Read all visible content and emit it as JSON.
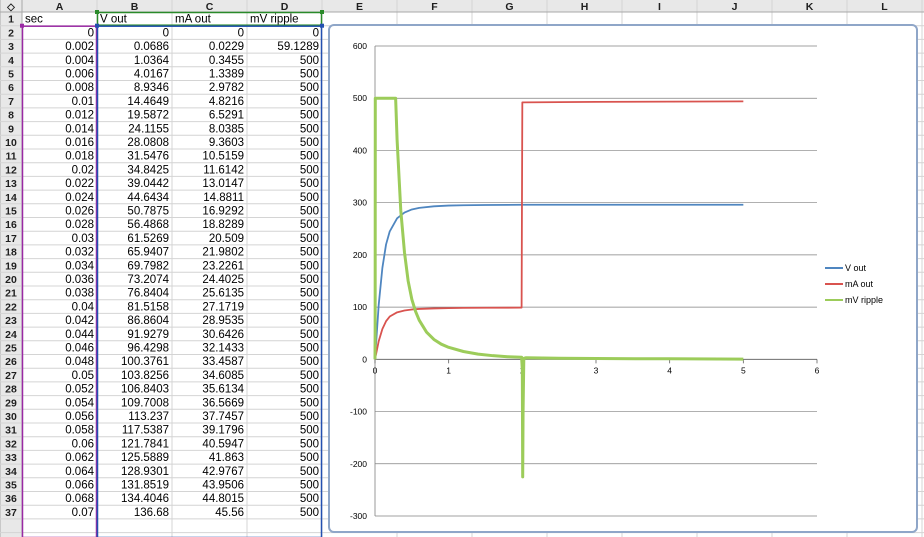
{
  "sheet": {
    "corner_label": "◇",
    "column_headers": [
      "A",
      "B",
      "C",
      "D",
      "E",
      "F",
      "G",
      "H",
      "I",
      "J",
      "K",
      "L"
    ],
    "row_headers": [
      "1",
      "2",
      "3",
      "4",
      "5",
      "6",
      "7",
      "8",
      "9",
      "10",
      "11",
      "12",
      "13",
      "14",
      "15",
      "16",
      "17",
      "18",
      "19",
      "20",
      "21",
      "22",
      "23",
      "24",
      "25",
      "26",
      "27",
      "28",
      "29",
      "30",
      "31",
      "32",
      "33",
      "34",
      "35",
      "36",
      "37"
    ],
    "header_cells": [
      "sec",
      "V out",
      "mA out",
      "mV ripple"
    ],
    "rows": [
      [
        "0",
        "0",
        "0",
        "0"
      ],
      [
        "0.002",
        "0.0686",
        "0.0229",
        "59.1289"
      ],
      [
        "0.004",
        "1.0364",
        "0.3455",
        "500"
      ],
      [
        "0.006",
        "4.0167",
        "1.3389",
        "500"
      ],
      [
        "0.008",
        "8.9346",
        "2.9782",
        "500"
      ],
      [
        "0.01",
        "14.4649",
        "4.8216",
        "500"
      ],
      [
        "0.012",
        "19.5872",
        "6.5291",
        "500"
      ],
      [
        "0.014",
        "24.1155",
        "8.0385",
        "500"
      ],
      [
        "0.016",
        "28.0808",
        "9.3603",
        "500"
      ],
      [
        "0.018",
        "31.5476",
        "10.5159",
        "500"
      ],
      [
        "0.02",
        "34.8425",
        "11.6142",
        "500"
      ],
      [
        "0.022",
        "39.0442",
        "13.0147",
        "500"
      ],
      [
        "0.024",
        "44.6434",
        "14.8811",
        "500"
      ],
      [
        "0.026",
        "50.7875",
        "16.9292",
        "500"
      ],
      [
        "0.028",
        "56.4868",
        "18.8289",
        "500"
      ],
      [
        "0.03",
        "61.5269",
        "20.509",
        "500"
      ],
      [
        "0.032",
        "65.9407",
        "21.9802",
        "500"
      ],
      [
        "0.034",
        "69.7982",
        "23.2261",
        "500"
      ],
      [
        "0.036",
        "73.2074",
        "24.4025",
        "500"
      ],
      [
        "0.038",
        "76.8404",
        "25.6135",
        "500"
      ],
      [
        "0.04",
        "81.5158",
        "27.1719",
        "500"
      ],
      [
        "0.042",
        "86.8604",
        "28.9535",
        "500"
      ],
      [
        "0.044",
        "91.9279",
        "30.6426",
        "500"
      ],
      [
        "0.046",
        "96.4298",
        "32.1433",
        "500"
      ],
      [
        "0.048",
        "100.3761",
        "33.4587",
        "500"
      ],
      [
        "0.05",
        "103.8256",
        "34.6085",
        "500"
      ],
      [
        "0.052",
        "106.8403",
        "35.6134",
        "500"
      ],
      [
        "0.054",
        "109.7008",
        "36.5669",
        "500"
      ],
      [
        "0.056",
        "113.237",
        "37.7457",
        "500"
      ],
      [
        "0.058",
        "117.5387",
        "39.1796",
        "500"
      ],
      [
        "0.06",
        "121.7841",
        "40.5947",
        "500"
      ],
      [
        "0.062",
        "125.5889",
        "41.863",
        "500"
      ],
      [
        "0.064",
        "128.9301",
        "42.9767",
        "500"
      ],
      [
        "0.066",
        "131.8519",
        "43.9506",
        "500"
      ],
      [
        "0.068",
        "134.4046",
        "44.8015",
        "500"
      ],
      [
        "0.07",
        "136.68",
        "45.56",
        "500"
      ]
    ],
    "colors": {
      "grid_line": "#d4d4d4",
      "header_fill": "#e8e8e8",
      "header_border": "#a8a8a8",
      "selection_purple": "#9a2aa4",
      "selection_green": "#2a8a2a",
      "selection_blue": "#2450b0"
    }
  },
  "chart_data": {
    "type": "line",
    "xlim": [
      0,
      6
    ],
    "ylim": [
      -300,
      600
    ],
    "x_ticks": [
      "0",
      "1",
      "2",
      "3",
      "4",
      "5",
      "6"
    ],
    "y_ticks": [
      "600",
      "500",
      "400",
      "300",
      "200",
      "100",
      "0",
      "-100",
      "-200",
      "-300"
    ],
    "grid": true,
    "legend_position": "right",
    "series": [
      {
        "name": "V out",
        "color": "#4f86c0",
        "x": [
          0,
          0.05,
          0.1,
          0.15,
          0.2,
          0.3,
          0.4,
          0.5,
          0.6,
          0.8,
          1,
          1.2,
          1.5,
          2,
          2.02,
          2.5,
          3,
          4,
          5
        ],
        "y": [
          0,
          103.8,
          175,
          220,
          245,
          270,
          281,
          287,
          290,
          293,
          294.5,
          295,
          295.5,
          296,
          296,
          296,
          296,
          296,
          296
        ]
      },
      {
        "name": "mA out",
        "color": "#d9534f",
        "x": [
          0,
          0.05,
          0.1,
          0.15,
          0.2,
          0.3,
          0.4,
          0.5,
          0.6,
          0.8,
          1,
          1.2,
          1.5,
          1.99,
          2,
          2.02,
          2.5,
          3,
          4,
          5
        ],
        "y": [
          0,
          34.6,
          58,
          73,
          82,
          90,
          93.5,
          95.5,
          96.5,
          97.5,
          98,
          98.5,
          98.8,
          99,
          492,
          492,
          492.5,
          493,
          493.5,
          494
        ]
      },
      {
        "name": "mV ripple",
        "color": "#9ccc5a",
        "x": [
          0,
          0.002,
          0.004,
          0.28,
          0.3,
          0.35,
          0.4,
          0.45,
          0.5,
          0.55,
          0.6,
          0.7,
          0.8,
          0.9,
          1,
          1.2,
          1.4,
          1.6,
          1.8,
          1.99,
          2,
          2.005,
          2.01,
          2.02,
          2.05,
          2.5,
          3,
          4,
          5
        ],
        "y": [
          0,
          59.1,
          500,
          500,
          420,
          285,
          205,
          150,
          115,
          92,
          75,
          52,
          38,
          29,
          23,
          15,
          10,
          7,
          5,
          4,
          -20,
          -225,
          -100,
          2,
          3,
          2,
          1.5,
          1,
          0.5
        ]
      }
    ]
  }
}
